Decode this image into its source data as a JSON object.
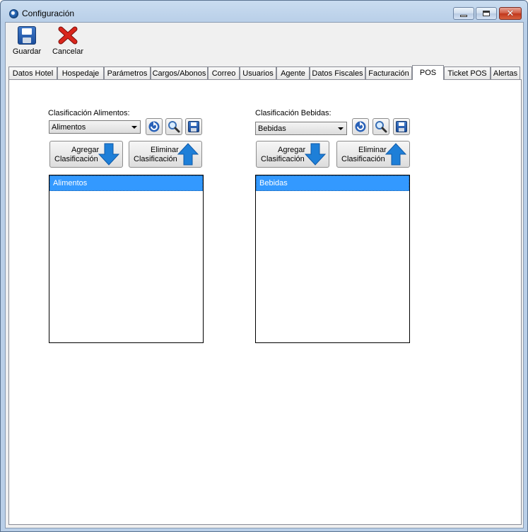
{
  "window": {
    "title": "Configuración"
  },
  "toolbar": {
    "save_label": "Guardar",
    "cancel_label": "Cancelar"
  },
  "tabs": [
    {
      "label": "Datos Hotel"
    },
    {
      "label": "Hospedaje"
    },
    {
      "label": "Parámetros"
    },
    {
      "label": "Cargos/Abonos"
    },
    {
      "label": "Correo"
    },
    {
      "label": "Usuarios"
    },
    {
      "label": "Agente"
    },
    {
      "label": "Datos Fiscales"
    },
    {
      "label": "Facturación"
    },
    {
      "label": "POS",
      "active": true
    },
    {
      "label": "Ticket POS"
    },
    {
      "label": "Alertas"
    }
  ],
  "alimentos": {
    "label": "Clasificación Alimentos:",
    "combo_value": "Alimentos",
    "add_line1": "Agregar",
    "add_line2": "Clasificación",
    "remove_line1": "Eliminar",
    "remove_line2": "Clasificación",
    "items": [
      "Alimentos"
    ]
  },
  "bebidas": {
    "label": "Clasificación Bebidas:",
    "combo_value": "Bebidas",
    "add_line1": "Agregar",
    "add_line2": "Clasificación",
    "remove_line1": "Eliminar",
    "remove_line2": "Clasificación",
    "items": [
      "Bebidas"
    ]
  },
  "icons": {
    "app": "app-icon",
    "save": "floppy-disk-icon",
    "cancel": "red-x-icon",
    "refresh": "refresh-icon",
    "search": "magnifier-icon",
    "save_small": "floppy-disk-icon",
    "down_arrow": "blue-down-arrow-icon",
    "up_arrow": "blue-up-arrow-icon"
  },
  "colors": {
    "selection": "#3399ff",
    "close_button": "#c0361c",
    "arrow_blue": "#1e7fd8"
  }
}
